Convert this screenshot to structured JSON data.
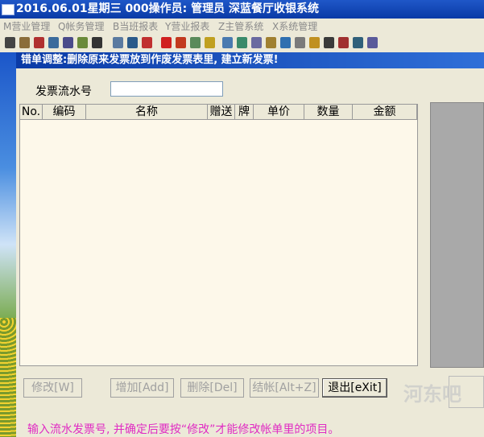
{
  "window": {
    "title": "2016.06.01星期三   000操作员: 管理员   深蓝餐厅收银系统"
  },
  "menu": [
    {
      "label": "M营业管理"
    },
    {
      "label": "Q帐务管理"
    },
    {
      "label": "B当班报表"
    },
    {
      "label": "Y营业报表"
    },
    {
      "label": "Z主管系统"
    },
    {
      "label": "X系统管理"
    }
  ],
  "toolbar_icons": [
    "pointer-icon",
    "print-icon",
    "doc-icon",
    "edit-icon",
    "copy-icon",
    "paste-icon",
    "cut-icon",
    "report-icon",
    "table-icon",
    "check-icon",
    "cancel-icon",
    "stop-icon",
    "person-icon",
    "money-icon",
    "search-icon",
    "tree-icon",
    "info-icon",
    "lock-icon",
    "globe-icon",
    "dots-icon",
    "flash-icon",
    "key-icon",
    "exit-icon",
    "calendar-icon",
    "help-icon"
  ],
  "dialog": {
    "title": "错单调整:删除原来发票放到作废发票表里, 建立新发票!",
    "serial_label": "发票流水号",
    "serial_value": "",
    "columns": [
      "No.",
      "编码",
      "名称",
      "赠送",
      "牌",
      "单价",
      "数量",
      "金额"
    ],
    "rows": []
  },
  "buttons": {
    "modify": "修改[W]",
    "add": "增加[Add]",
    "delete": "删除[Del]",
    "checkout": "结帐[Alt+Z]",
    "exit": "退出[eXit]"
  },
  "hint": "输入流水发票号, 并确定后要按“修改”才能修改帐单里的项目。",
  "watermark": "河东吧"
}
